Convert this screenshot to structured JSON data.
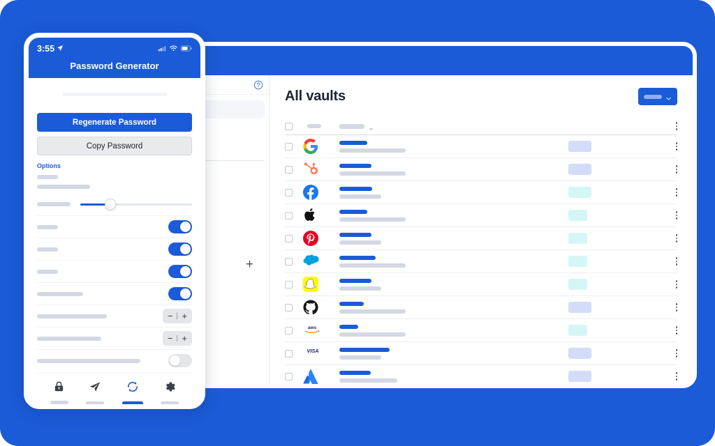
{
  "theme": {
    "brand_blue": "#1b5bd7",
    "skeleton_grey": "#d3d8e2",
    "badge_lavender": "#d3ddf7",
    "badge_cyan": "#d4f7f5"
  },
  "phone": {
    "status": {
      "time": "3:55",
      "location_icon": "location-arrow-icon",
      "signal_icon": "signal-bars-icon",
      "wifi_icon": "wifi-icon",
      "battery_icon": "battery-icon"
    },
    "title": "Password Generator",
    "primary_button": "Regenerate Password",
    "secondary_button": "Copy Password",
    "options_label": "Options",
    "option_rows": [
      {
        "name": "option-length",
        "control": "slider",
        "slider_value": 23
      },
      {
        "name": "option-uppercase",
        "control": "toggle",
        "on": true
      },
      {
        "name": "option-lowercase",
        "control": "toggle",
        "on": true
      },
      {
        "name": "option-numbers",
        "control": "toggle",
        "on": true
      },
      {
        "name": "option-symbols",
        "control": "toggle",
        "on": true
      },
      {
        "name": "option-min-numbers",
        "control": "stepper"
      },
      {
        "name": "option-min-symbols",
        "control": "stepper"
      },
      {
        "name": "option-avoid-ambiguous",
        "control": "toggle",
        "on": false
      }
    ],
    "stepper": {
      "minus": "−",
      "plus": "+"
    },
    "nav": [
      {
        "name": "nav-vault",
        "icon": "lock-icon",
        "active": false
      },
      {
        "name": "nav-send",
        "icon": "paper-plane-icon",
        "active": false
      },
      {
        "name": "nav-generator",
        "icon": "refresh-icon",
        "active": true
      },
      {
        "name": "nav-settings",
        "icon": "gear-icon",
        "active": false
      }
    ]
  },
  "desktop": {
    "sidebar": {
      "help_icon": "help-circle-icon",
      "add_icon": "plus-icon"
    },
    "title": "All vaults",
    "action_button": {
      "icon": "chevron-down-icon"
    },
    "table": {
      "header": {
        "select_all": "checkbox",
        "col_name_sortable": true,
        "sort_icon": "caret-down-icon"
      },
      "rows": [
        {
          "logo": "google-icon",
          "name_w": 40,
          "sub_w": 95,
          "badge_w": 33,
          "badge": "lavender"
        },
        {
          "logo": "hubspot-icon",
          "name_w": 46,
          "sub_w": 95,
          "badge_w": 33,
          "badge": "lavender"
        },
        {
          "logo": "facebook-icon",
          "name_w": 47,
          "sub_w": 60,
          "badge_w": 33,
          "badge": "cyan"
        },
        {
          "logo": "apple-icon",
          "name_w": 40,
          "sub_w": 95,
          "badge_w": 27,
          "badge": "cyan"
        },
        {
          "logo": "pinterest-icon",
          "name_w": 46,
          "sub_w": 60,
          "badge_w": 27,
          "badge": "cyan"
        },
        {
          "logo": "salesforce-icon",
          "name_w": 52,
          "sub_w": 95,
          "badge_w": 27,
          "badge": "cyan"
        },
        {
          "logo": "snapchat-icon",
          "name_w": 46,
          "sub_w": 60,
          "badge_w": 27,
          "badge": "cyan"
        },
        {
          "logo": "github-icon",
          "name_w": 35,
          "sub_w": 95,
          "badge_w": 33,
          "badge": "lavender"
        },
        {
          "logo": "aws-icon",
          "name_w": 27,
          "sub_w": 95,
          "badge_w": 27,
          "badge": "cyan"
        },
        {
          "logo": "visa-icon",
          "name_w": 72,
          "sub_w": 60,
          "badge_w": 33,
          "badge": "lavender"
        },
        {
          "logo": "atlassian-icon",
          "name_w": 45,
          "sub_w": 83,
          "badge_w": 33,
          "badge": "lavender"
        }
      ]
    }
  }
}
